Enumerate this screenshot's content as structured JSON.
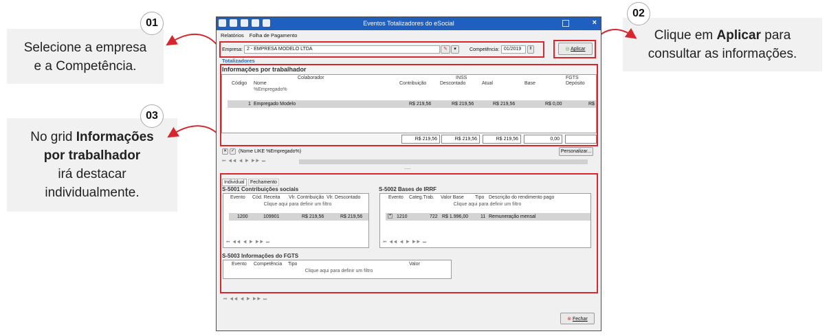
{
  "callouts": [
    {
      "badge": "01",
      "text_plain": "Selecione a empresa e a Competência."
    },
    {
      "badge": "02",
      "text_pre": "Clique em ",
      "text_bold": "Aplicar",
      "text_post": " para consultar as informações."
    },
    {
      "badge": "03",
      "text_pre": "No grid ",
      "text_bold": "Informações por trabalhador",
      "text_post": " irá destacar individualmente."
    }
  ],
  "callout1": {
    "line1": "Selecione a empresa",
    "line2": "e a Competência."
  },
  "callout2": {
    "pre": "Clique em ",
    "bold": "Aplicar",
    "post1": " para",
    "line2": "consultar as informações."
  },
  "callout3": {
    "pre": "No grid ",
    "bold1": "Informações",
    "bold2": "por trabalhador",
    "line3": "irá destacar",
    "line4": "individualmente."
  },
  "window": {
    "title": "Eventos Totalizadores do eSocial",
    "close": "×",
    "menu": [
      "Relatórios",
      "Folha de Pagamento"
    ]
  },
  "filters": {
    "empresa_label": "Empresa:",
    "empresa_value": "2 - EMPRESA MODELO LTDA",
    "competencia_label": "Competência:",
    "competencia_value": "01/2019",
    "apply_label": "Aplicar"
  },
  "totalizadores_label": "Totalizadores",
  "trabalhador": {
    "title": "Informações por trabalhador",
    "group_headers": [
      "Colaborador",
      "INSS",
      "FGTS"
    ],
    "columns": [
      "Código",
      "Nome",
      "Contribuição",
      "Descontado",
      "Atual",
      "Base",
      "Depósito"
    ],
    "filter_row_name": "%Empregado%",
    "row": {
      "codigo": "1",
      "nome": "Empregado Modelo",
      "contribuicao": "R$ 219,56",
      "descontado": "R$ 219,56",
      "atual": "R$ 219,56",
      "base": "R$ 0,00",
      "deposito": "R$"
    },
    "totals": [
      "R$ 219,56",
      "R$ 219,56",
      "R$ 219,56",
      "0,00",
      ""
    ],
    "filter_expression": "(Nome LIKE %Empregado%)",
    "customize_label": "Personalizar...",
    "dots": "....."
  },
  "tabs": [
    "Individual",
    "Fechamento"
  ],
  "s5001": {
    "title": "S-5001 Contribuições sociais",
    "columns": [
      "Evento",
      "Cód. Receita",
      "Vlr. Contribuição",
      "Vlr. Descontado"
    ],
    "filter_hint": "Clique aqui para definir um filtro",
    "row": {
      "evento": "1200",
      "cod": "109901",
      "contrib": "R$ 219,56",
      "desc": "R$ 219,56"
    }
  },
  "s5002": {
    "title": "S-5002 Bases de IRRF",
    "columns": [
      "Evento",
      "Categ.Trab.",
      "Valor Base",
      "Tipo",
      "Descrição do rendimento pago"
    ],
    "filter_hint": "Clique aqui para definir um filtro",
    "row": {
      "evento": "1210",
      "categ": "722",
      "valor": "R$ 1.996,00",
      "tipo": "11",
      "desc": "Remuneração mensal"
    }
  },
  "s5003": {
    "title": "S-5003 Informações do FGTS",
    "columns": [
      "Evento",
      "Competência",
      "Tipo",
      "Valor"
    ],
    "filter_hint": "Clique aqui para definir um filtro"
  },
  "close_button": "Fechar",
  "nav": "⏮ ◀◀ ◀ ▶ ▶▶ ⏭",
  "colors": {
    "highlight": "#d8262e",
    "titlebar": "#1f5fbf",
    "accent_text": "#1a6cc6"
  }
}
